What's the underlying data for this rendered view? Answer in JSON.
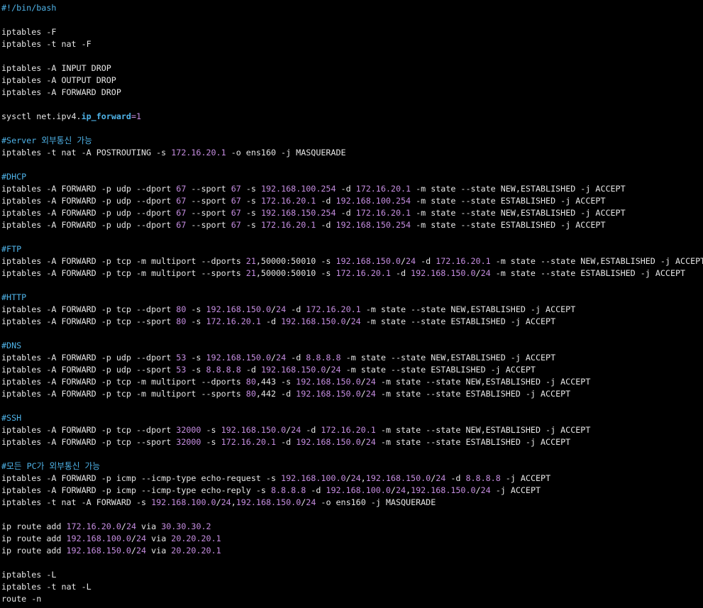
{
  "theme": {
    "background": "#000000",
    "text": "#e6e6e6",
    "comment": "#4fb3e8",
    "number": "#c58de0",
    "parameter": "#4fb3e8"
  },
  "lines": [
    [
      [
        "comment",
        "#!/bin/bash"
      ]
    ],
    [],
    [
      [
        "text",
        "iptables -F"
      ]
    ],
    [
      [
        "text",
        "iptables -t nat -F"
      ]
    ],
    [],
    [
      [
        "text",
        "iptables -A INPUT DROP"
      ]
    ],
    [
      [
        "text",
        "iptables -A OUTPUT DROP"
      ]
    ],
    [
      [
        "text",
        "iptables -A FORWARD DROP"
      ]
    ],
    [],
    [
      [
        "text",
        "sysctl net.ipv4."
      ],
      [
        "param",
        "ip_forward"
      ],
      [
        "op",
        "="
      ],
      [
        "num",
        "1"
      ]
    ],
    [],
    [
      [
        "comment",
        "#Server 외부통신 가능"
      ]
    ],
    [
      [
        "text",
        "iptables -t nat -A POSTROUTING -s "
      ],
      [
        "num",
        "172.16.20.1"
      ],
      [
        "text",
        " -o ens160 -j MASQUERADE"
      ]
    ],
    [],
    [
      [
        "comment",
        "#DHCP"
      ]
    ],
    [
      [
        "text",
        "iptables -A FORWARD -p udp --dport "
      ],
      [
        "num",
        "67"
      ],
      [
        "text",
        " --sport "
      ],
      [
        "num",
        "67"
      ],
      [
        "text",
        " -s "
      ],
      [
        "num",
        "192.168.100.254"
      ],
      [
        "text",
        " -d "
      ],
      [
        "num",
        "172.16.20.1"
      ],
      [
        "text",
        " -m state --state NEW,ESTABLISHED -j ACCEPT"
      ]
    ],
    [
      [
        "text",
        "iptables -A FORWARD -p udp --dport "
      ],
      [
        "num",
        "67"
      ],
      [
        "text",
        " --sport "
      ],
      [
        "num",
        "67"
      ],
      [
        "text",
        " -s "
      ],
      [
        "num",
        "172.16.20.1"
      ],
      [
        "text",
        " -d "
      ],
      [
        "num",
        "192.168.100.254"
      ],
      [
        "text",
        " -m state --state ESTABLISHED -j ACCEPT"
      ]
    ],
    [
      [
        "text",
        "iptables -A FORWARD -p udp --dport "
      ],
      [
        "num",
        "67"
      ],
      [
        "text",
        " --sport "
      ],
      [
        "num",
        "67"
      ],
      [
        "text",
        " -s "
      ],
      [
        "num",
        "192.168.150.254"
      ],
      [
        "text",
        " -d "
      ],
      [
        "num",
        "172.16.20.1"
      ],
      [
        "text",
        " -m state --state NEW,ESTABLISHED -j ACCEPT"
      ]
    ],
    [
      [
        "text",
        "iptables -A FORWARD -p udp --dport "
      ],
      [
        "num",
        "67"
      ],
      [
        "text",
        " --sport "
      ],
      [
        "num",
        "67"
      ],
      [
        "text",
        " -s "
      ],
      [
        "num",
        "172.16.20.1"
      ],
      [
        "text",
        " -d "
      ],
      [
        "num",
        "192.168.150.254"
      ],
      [
        "text",
        " -m state --state ESTABLISHED -j ACCEPT"
      ]
    ],
    [],
    [
      [
        "comment",
        "#FTP"
      ]
    ],
    [
      [
        "text",
        "iptables -A FORWARD -p tcp -m multiport --dports "
      ],
      [
        "num",
        "21"
      ],
      [
        "text",
        ",50000:50010 -s "
      ],
      [
        "num",
        "192.168.150.0"
      ],
      [
        "text",
        "/"
      ],
      [
        "num",
        "24"
      ],
      [
        "text",
        " -d "
      ],
      [
        "num",
        "172.16.20.1"
      ],
      [
        "text",
        " -m state --state NEW,ESTABLISHED -j ACCEPT"
      ]
    ],
    [
      [
        "text",
        "iptables -A FORWARD -p tcp -m multiport --sports "
      ],
      [
        "num",
        "21"
      ],
      [
        "text",
        ",50000:50010 -s "
      ],
      [
        "num",
        "172.16.20.1"
      ],
      [
        "text",
        " -d "
      ],
      [
        "num",
        "192.168.150.0"
      ],
      [
        "text",
        "/"
      ],
      [
        "num",
        "24"
      ],
      [
        "text",
        " -m state --state ESTABLISHED -j ACCEPT"
      ]
    ],
    [],
    [
      [
        "comment",
        "#HTTP"
      ]
    ],
    [
      [
        "text",
        "iptables -A FORWARD -p tcp --dport "
      ],
      [
        "num",
        "80"
      ],
      [
        "text",
        " -s "
      ],
      [
        "num",
        "192.168.150.0"
      ],
      [
        "text",
        "/"
      ],
      [
        "num",
        "24"
      ],
      [
        "text",
        " -d "
      ],
      [
        "num",
        "172.16.20.1"
      ],
      [
        "text",
        " -m state --state NEW,ESTABLISHED -j ACCEPT"
      ]
    ],
    [
      [
        "text",
        "iptables -A FORWARD -p tcp --sport "
      ],
      [
        "num",
        "80"
      ],
      [
        "text",
        " -s "
      ],
      [
        "num",
        "172.16.20.1"
      ],
      [
        "text",
        " -d "
      ],
      [
        "num",
        "192.168.150.0"
      ],
      [
        "text",
        "/"
      ],
      [
        "num",
        "24"
      ],
      [
        "text",
        " -m state --state ESTABLISHED -j ACCEPT"
      ]
    ],
    [],
    [
      [
        "comment",
        "#DNS"
      ]
    ],
    [
      [
        "text",
        "iptables -A FORWARD -p udp --dport "
      ],
      [
        "num",
        "53"
      ],
      [
        "text",
        " -s "
      ],
      [
        "num",
        "192.168.150.0"
      ],
      [
        "text",
        "/"
      ],
      [
        "num",
        "24"
      ],
      [
        "text",
        " -d "
      ],
      [
        "num",
        "8.8.8.8"
      ],
      [
        "text",
        " -m state --state NEW,ESTABLISHED -j ACCEPT"
      ]
    ],
    [
      [
        "text",
        "iptables -A FORWARD -p udp --sport "
      ],
      [
        "num",
        "53"
      ],
      [
        "text",
        " -s "
      ],
      [
        "num",
        "8.8.8.8"
      ],
      [
        "text",
        " -d "
      ],
      [
        "num",
        "192.168.150.0"
      ],
      [
        "text",
        "/"
      ],
      [
        "num",
        "24"
      ],
      [
        "text",
        " -m state --state ESTABLISHED -j ACCEPT"
      ]
    ],
    [
      [
        "text",
        "iptables -A FORWARD -p tcp -m multiport --dports "
      ],
      [
        "num",
        "80"
      ],
      [
        "text",
        ",443 -s "
      ],
      [
        "num",
        "192.168.150.0"
      ],
      [
        "text",
        "/"
      ],
      [
        "num",
        "24"
      ],
      [
        "text",
        " -m state --state NEW,ESTABLISHED -j ACCEPT"
      ]
    ],
    [
      [
        "text",
        "iptables -A FORWARD -p tcp -m multiport --sports "
      ],
      [
        "num",
        "80"
      ],
      [
        "text",
        ",442 -d "
      ],
      [
        "num",
        "192.168.150.0"
      ],
      [
        "text",
        "/"
      ],
      [
        "num",
        "24"
      ],
      [
        "text",
        " -m state --state ESTABLISHED -j ACCEPT"
      ]
    ],
    [],
    [
      [
        "comment",
        "#SSH"
      ]
    ],
    [
      [
        "text",
        "iptables -A FORWARD -p tcp --dport "
      ],
      [
        "num",
        "32000"
      ],
      [
        "text",
        " -s "
      ],
      [
        "num",
        "192.168.150.0"
      ],
      [
        "text",
        "/"
      ],
      [
        "num",
        "24"
      ],
      [
        "text",
        " -d "
      ],
      [
        "num",
        "172.16.20.1"
      ],
      [
        "text",
        " -m state --state NEW,ESTABLISHED -j ACCEPT"
      ]
    ],
    [
      [
        "text",
        "iptables -A FORWARD -p tcp --sport "
      ],
      [
        "num",
        "32000"
      ],
      [
        "text",
        " -s "
      ],
      [
        "num",
        "172.16.20.1"
      ],
      [
        "text",
        " -d "
      ],
      [
        "num",
        "192.168.150.0"
      ],
      [
        "text",
        "/"
      ],
      [
        "num",
        "24"
      ],
      [
        "text",
        " -m state --state ESTABLISHED -j ACCEPT"
      ]
    ],
    [],
    [
      [
        "comment",
        "#모든 PC가 외부통신 가능"
      ]
    ],
    [
      [
        "text",
        "iptables -A FORWARD -p icmp --icmp-type echo-request -s "
      ],
      [
        "num",
        "192.168.100.0"
      ],
      [
        "text",
        "/"
      ],
      [
        "num",
        "24"
      ],
      [
        "text",
        ","
      ],
      [
        "num",
        "192.168.150.0"
      ],
      [
        "text",
        "/"
      ],
      [
        "num",
        "24"
      ],
      [
        "text",
        " -d "
      ],
      [
        "num",
        "8.8.8.8"
      ],
      [
        "text",
        " -j ACCEPT"
      ]
    ],
    [
      [
        "text",
        "iptables -A FORWARD -p icmp --icmp-type echo-reply -s "
      ],
      [
        "num",
        "8.8.8.8"
      ],
      [
        "text",
        " -d "
      ],
      [
        "num",
        "192.168.100.0"
      ],
      [
        "text",
        "/"
      ],
      [
        "num",
        "24"
      ],
      [
        "text",
        ","
      ],
      [
        "num",
        "192.168.150.0"
      ],
      [
        "text",
        "/"
      ],
      [
        "num",
        "24"
      ],
      [
        "text",
        " -j ACCEPT"
      ]
    ],
    [
      [
        "text",
        "iptables -t nat -A FORWARD -s "
      ],
      [
        "num",
        "192.168.100.0"
      ],
      [
        "text",
        "/"
      ],
      [
        "num",
        "24"
      ],
      [
        "text",
        ","
      ],
      [
        "num",
        "192.168.150.0"
      ],
      [
        "text",
        "/"
      ],
      [
        "num",
        "24"
      ],
      [
        "text",
        " -o ens160 -j MASQUERADE"
      ]
    ],
    [],
    [
      [
        "text",
        "ip route add "
      ],
      [
        "num",
        "172.16.20.0"
      ],
      [
        "text",
        "/"
      ],
      [
        "num",
        "24"
      ],
      [
        "text",
        " via "
      ],
      [
        "num",
        "30.30.30.2"
      ]
    ],
    [
      [
        "text",
        "ip route add "
      ],
      [
        "num",
        "192.168.100.0"
      ],
      [
        "text",
        "/"
      ],
      [
        "num",
        "24"
      ],
      [
        "text",
        " via "
      ],
      [
        "num",
        "20.20.20.1"
      ]
    ],
    [
      [
        "text",
        "ip route add "
      ],
      [
        "num",
        "192.168.150.0"
      ],
      [
        "text",
        "/"
      ],
      [
        "num",
        "24"
      ],
      [
        "text",
        " via "
      ],
      [
        "num",
        "20.20.20.1"
      ]
    ],
    [],
    [
      [
        "text",
        "iptables -L"
      ]
    ],
    [
      [
        "text",
        "iptables -t nat -L"
      ]
    ],
    [
      [
        "text",
        "route -n"
      ]
    ]
  ]
}
